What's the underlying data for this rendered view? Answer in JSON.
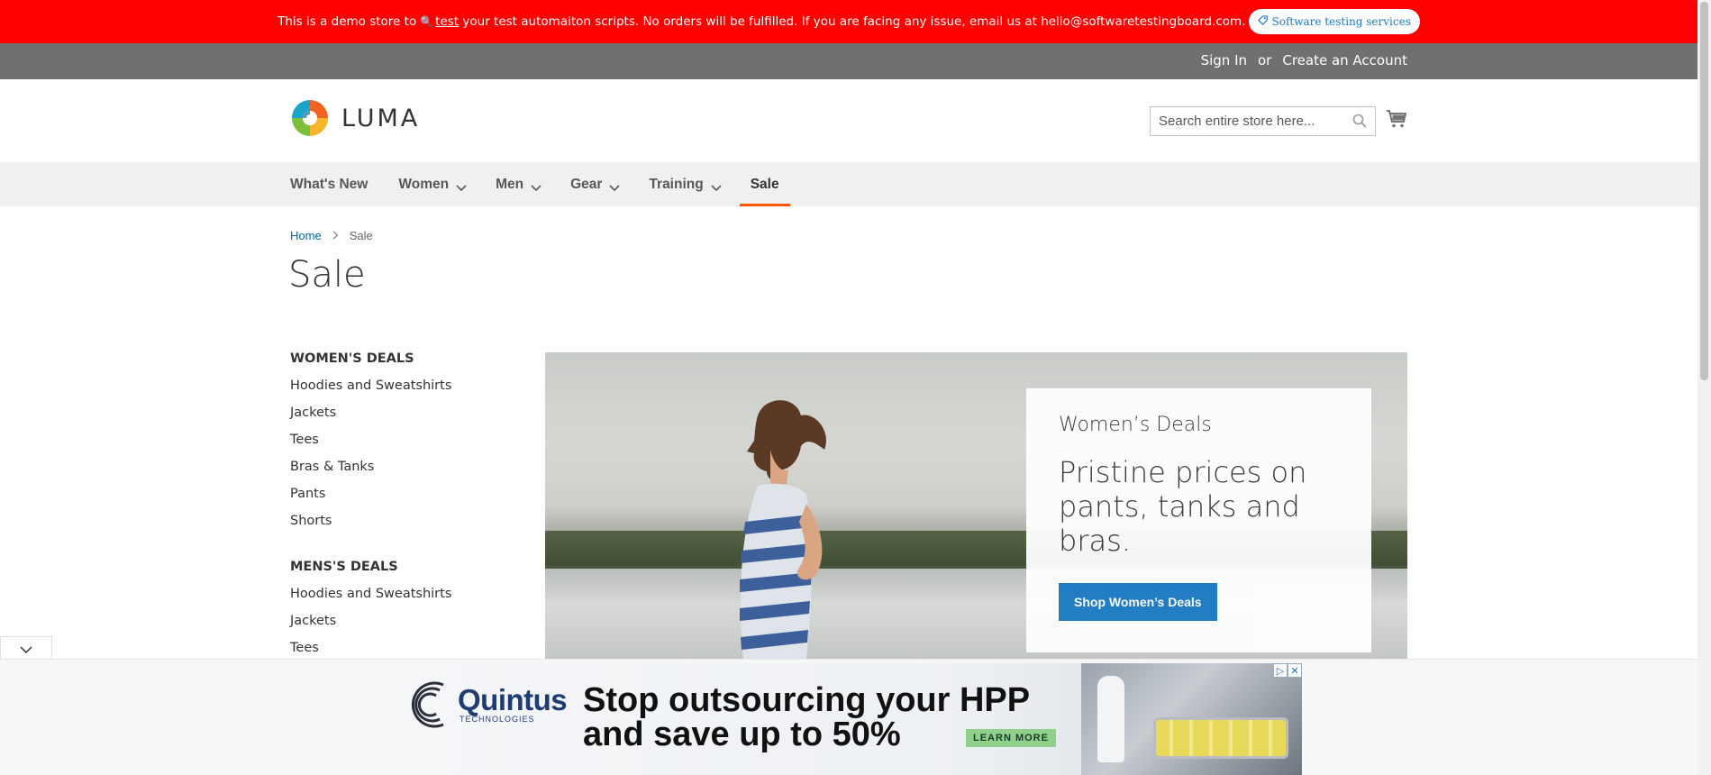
{
  "demo_notice": {
    "text_before": "This is a demo store to",
    "link_text": "test",
    "text_after": "your test automaiton scripts. No orders will be fulfilled. If you are facing any issue, email us at hello@softwaretestingboard.com.",
    "pill_label": "Software testing services"
  },
  "panel": {
    "sign_in": "Sign In",
    "or": "or",
    "create_account": "Create an Account"
  },
  "header": {
    "logo_text": "LUMA",
    "search_placeholder": "Search entire store here..."
  },
  "nav": {
    "items": [
      {
        "label": "What's New",
        "has_submenu": false
      },
      {
        "label": "Women",
        "has_submenu": true
      },
      {
        "label": "Men",
        "has_submenu": true
      },
      {
        "label": "Gear",
        "has_submenu": true
      },
      {
        "label": "Training",
        "has_submenu": true
      },
      {
        "label": "Sale",
        "has_submenu": false,
        "active": true
      }
    ]
  },
  "breadcrumb": {
    "home": "Home",
    "current": "Sale"
  },
  "page_title": "Sale",
  "sidebar": {
    "womens": {
      "heading": "WOMEN'S DEALS",
      "items": [
        "Hoodies and Sweatshirts",
        "Jackets",
        "Tees",
        "Bras & Tanks",
        "Pants",
        "Shorts"
      ]
    },
    "mens": {
      "heading": "MENS'S DEALS",
      "items": [
        "Hoodies and Sweatshirts",
        "Jackets",
        "Tees"
      ]
    }
  },
  "promo": {
    "subtitle": "Women’s Deals",
    "headline": "Pristine prices on pants, tanks and bras.",
    "button": "Shop Women’s Deals"
  },
  "ad": {
    "brand": "Quintus",
    "brand_sub": "TECHNOLOGIES",
    "headline_line1": "Stop outsourcing your HPP",
    "headline_line2": "and save up to 50%",
    "cta": "LEARN MORE"
  },
  "colors": {
    "demo_bar": "#ff0000",
    "panel": "#6e716e",
    "nav_bg": "#f0f0f0",
    "link": "#006bb4",
    "button": "#1979c3",
    "active_underline": "#ff5501"
  }
}
